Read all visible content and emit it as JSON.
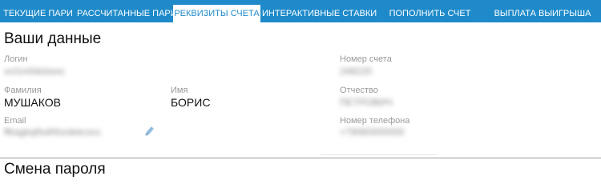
{
  "tabs": [
    {
      "label": "ТЕКУЩИЕ ПАРИ",
      "active": false
    },
    {
      "label": "РАССЧИТАННЫЕ ПАРИ",
      "active": false
    },
    {
      "label": "РЕКВИЗИТЫ СЧЕТА",
      "active": true
    },
    {
      "label": "ИНТЕРАКТИВНЫЕ СТАВКИ",
      "active": false
    },
    {
      "label": "ПОПОЛНИТЬ СЧЕТ",
      "active": false
    },
    {
      "label": "ВЫПЛАТА ВЫИГРЫША",
      "active": false
    }
  ],
  "colors": {
    "tabbar": "#1f8ac9",
    "label": "#9a9a9a",
    "active_tab_text": "#1f8ac9"
  },
  "profile": {
    "title": "Ваши данные",
    "login": {
      "label": "Логин",
      "value": "vcl1m0dcbsnc"
    },
    "account_number": {
      "label": "Номер счета",
      "value": "248220"
    },
    "last_name": {
      "label": "Фамилия",
      "value": "МУШАКОВ"
    },
    "first_name": {
      "label": "Имя",
      "value": "БОРИС"
    },
    "patronymic": {
      "label": "Отчество",
      "value": "ПЕТРОВИЧ"
    },
    "email": {
      "label": "Email",
      "value": "ffkagkqtfsdhfurdekcsru"
    },
    "phone": {
      "label": "Номер телефона",
      "value": "+79060000000"
    },
    "edit_icon": "pencil-icon"
  },
  "password_section": {
    "title": "Смена пароля"
  }
}
